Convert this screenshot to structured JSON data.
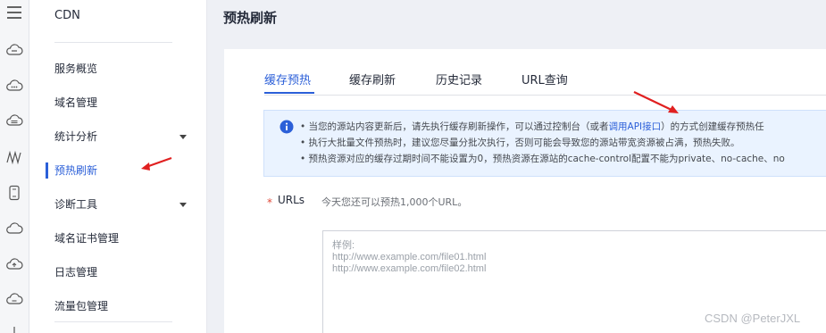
{
  "rail": {
    "icons": [
      "menu-icon",
      "cloud-server-icon",
      "cloud-more-icon",
      "cloud-disk-icon",
      "cdn-wave-icon",
      "phone-icon",
      "cloud-icon",
      "cloud-upload-icon",
      "cloud-sync-icon"
    ]
  },
  "nav": {
    "title": "CDN",
    "items": [
      {
        "label": "服务概览",
        "has_children": false
      },
      {
        "label": "域名管理",
        "has_children": false
      },
      {
        "label": "统计分析",
        "has_children": true
      },
      {
        "label": "预热刷新",
        "has_children": false,
        "active": true
      },
      {
        "label": "诊断工具",
        "has_children": true
      },
      {
        "label": "域名证书管理",
        "has_children": false
      },
      {
        "label": "日志管理",
        "has_children": false
      },
      {
        "label": "流量包管理",
        "has_children": false
      }
    ]
  },
  "page": {
    "title": "预热刷新"
  },
  "tabs": [
    {
      "label": "缓存预热",
      "active": true
    },
    {
      "label": "缓存刷新",
      "active": false
    },
    {
      "label": "历史记录",
      "active": false
    },
    {
      "label": "URL查询",
      "active": false
    }
  ],
  "notice": {
    "line1_pre": "• 当您的源站内容更新后，请先执行缓存刷新操作，可以通过控制台（或者",
    "line1_link": "调用API接口",
    "line1_post": "）的方式创建缓存预热任",
    "line2": "• 执行大批量文件预热时，建议您尽量分批次执行，否则可能会导致您的源站带宽资源被占满，预热失败。",
    "line3": "• 预热资源对应的缓存过期时间不能设置为0，预热资源在源站的cache-control配置不能为private、no-cache、no"
  },
  "form": {
    "required_mark": "*",
    "label": "URLs",
    "hint": "今天您还可以预热1,000个URL。",
    "placeholder_lines": [
      "样例:",
      "http://www.example.com/file01.html",
      "http://www.example.com/file02.html"
    ]
  },
  "watermark": "CSDN @PeterJXL",
  "colors": {
    "accent": "#2b5fd8",
    "annotation_arrow": "#e02020"
  }
}
